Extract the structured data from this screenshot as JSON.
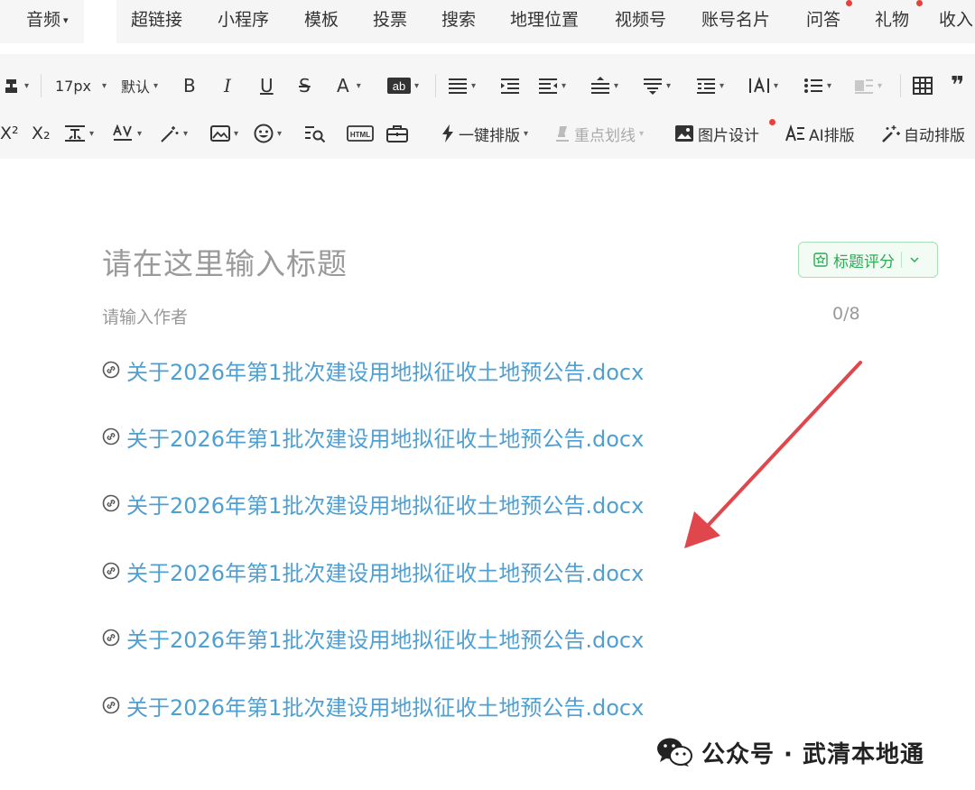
{
  "tabs": [
    {
      "label": "音频",
      "has_caret": true
    },
    {
      "label": "超链接"
    },
    {
      "label": "小程序"
    },
    {
      "label": "模板"
    },
    {
      "label": "投票"
    },
    {
      "label": "搜索"
    },
    {
      "label": "地理位置"
    },
    {
      "label": "视频号"
    },
    {
      "label": "账号名片"
    },
    {
      "label": "问答"
    },
    {
      "label": "礼物"
    },
    {
      "label": "收入"
    }
  ],
  "toolbar": {
    "font_size": "17px",
    "font_family": "默认",
    "one_click_layout": "一键排版",
    "highlight_line": "重点划线",
    "image_design": "图片设计",
    "ai_layout": "AI排版",
    "auto_layout": "自动排版",
    "bold": "B",
    "italic": "I",
    "underline": "U",
    "strike": "S",
    "font_color": "A",
    "superscript": "X²",
    "subscript": "X₂"
  },
  "editor": {
    "title_placeholder": "请在这里输入标题",
    "title_score_label": "标题评分",
    "author_placeholder": "请输入作者",
    "author_counter": "0/8",
    "links": [
      "关于2026年第1批次建设用地拟征收土地预公告.docx",
      "关于2026年第1批次建设用地拟征收土地预公告.docx",
      "关于2026年第1批次建设用地拟征收土地预公告.docx",
      "关于2026年第1批次建设用地拟征收土地预公告.docx",
      "关于2026年第1批次建设用地拟征收土地预公告.docx",
      "关于2026年第1批次建设用地拟征收土地预公告.docx"
    ]
  },
  "watermark": {
    "text": "公众号 · 武清本地通"
  },
  "colors": {
    "link": "#4f9fd1",
    "score_green": "#2faa55",
    "arrow_red": "#e0474c",
    "badge_red": "#e8403a"
  }
}
